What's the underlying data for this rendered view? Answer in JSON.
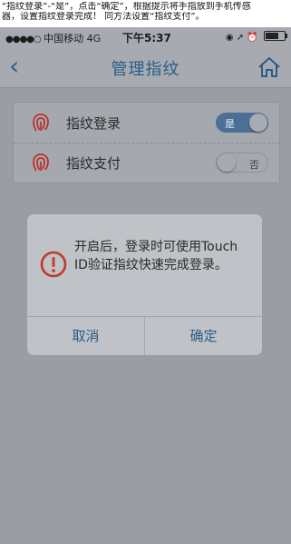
{
  "caption": {
    "line1": "“指纹登录”-“是”，点击“确定”，根据提示将手指放到手机传感",
    "line2": "器，设置指纹登录完成！ 同方法设置“指纹支付”。"
  },
  "status_bar": {
    "signal": "●●●●○",
    "carrier": "中国移动",
    "network": "4G",
    "time": "下午5:37",
    "right_icons": "◉ ➚ ⏰"
  },
  "nav": {
    "back_icon": "‹",
    "title": "管理指纹",
    "home_icon": "home-icon"
  },
  "settings": {
    "rows": [
      {
        "label": "指纹登录",
        "toggle_text": "是",
        "state": "on"
      },
      {
        "label": "指纹支付",
        "toggle_text": "否",
        "state": "off"
      }
    ]
  },
  "dialog": {
    "message": "开启后，登录时可使用Touch ID验证指纹快速完成登录。",
    "cancel": "取消",
    "confirm": "确定",
    "icon": "alert-icon"
  },
  "colors": {
    "accent": "#2b5c86",
    "alert_red": "#c0392b",
    "toggle_on": "#4d6f95"
  }
}
